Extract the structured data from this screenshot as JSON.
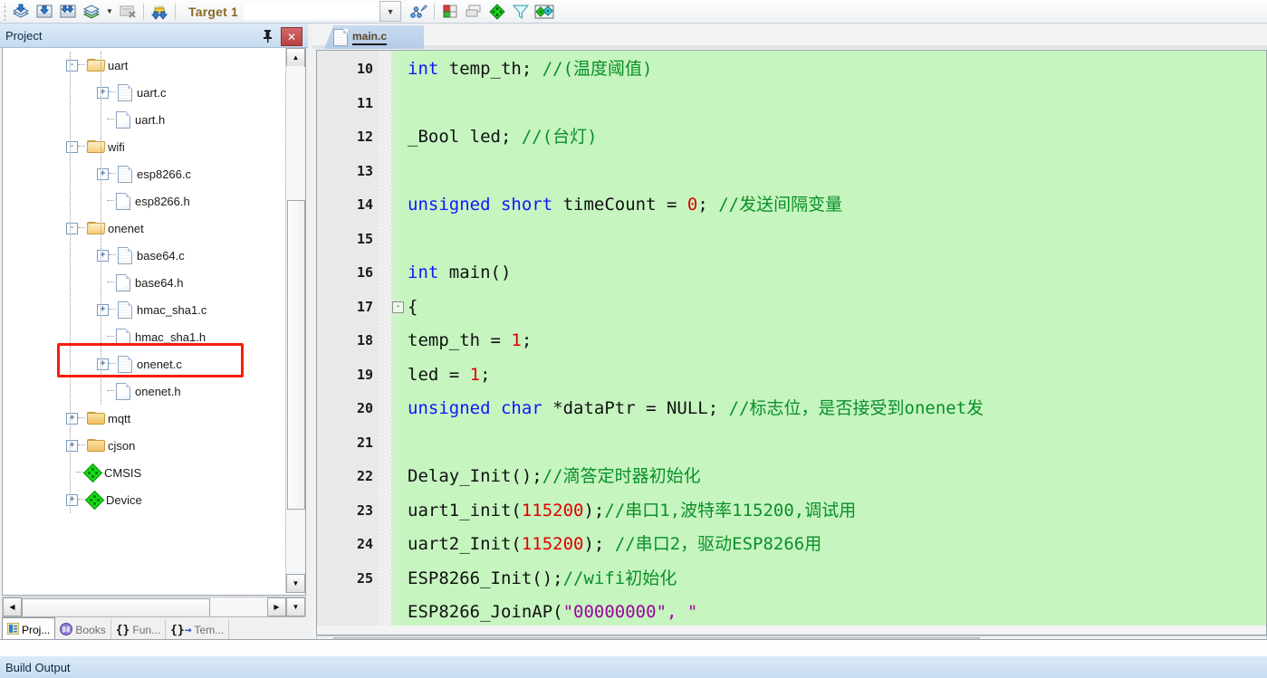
{
  "toolbar": {
    "icons": [
      "build-target-icon",
      "download-to-flash-icon",
      "download-all-icon",
      "batch-build-icon",
      "batch-build-dropdown-icon",
      "translate-file-icon",
      "options-for-target-icon"
    ],
    "target_label": "Target 1",
    "target_dropdown_icon": "chevron-down-icon",
    "right_icons": [
      "manage-runtime-env-icon",
      "new-window-icon",
      "multi-project-icon",
      "diamond-green-icon",
      "filter-icon",
      "pack-installer-icon"
    ]
  },
  "project_panel": {
    "title": "Project",
    "pin_icon": "pin-icon",
    "close_icon": "close-icon",
    "tree": [
      {
        "label": "uart",
        "depth": 1,
        "toggle": "-",
        "icon": "folder-open-icon",
        "row": 0
      },
      {
        "label": "uart.c",
        "depth": 2,
        "toggle": "+",
        "icon": "c-file-icon",
        "row": 1
      },
      {
        "label": "uart.h",
        "depth": 2,
        "toggle": "",
        "icon": "h-file-icon",
        "row": 2
      },
      {
        "label": "wifi",
        "depth": 1,
        "toggle": "-",
        "icon": "folder-open-icon",
        "row": 3
      },
      {
        "label": "esp8266.c",
        "depth": 2,
        "toggle": "+",
        "icon": "c-file-icon",
        "row": 4
      },
      {
        "label": "esp8266.h",
        "depth": 2,
        "toggle": "",
        "icon": "h-file-icon",
        "row": 5
      },
      {
        "label": "onenet",
        "depth": 1,
        "toggle": "-",
        "icon": "folder-open-icon",
        "row": 6
      },
      {
        "label": "base64.c",
        "depth": 2,
        "toggle": "+",
        "icon": "c-file-icon",
        "row": 7
      },
      {
        "label": "base64.h",
        "depth": 2,
        "toggle": "",
        "icon": "h-file-icon",
        "row": 8
      },
      {
        "label": "hmac_sha1.c",
        "depth": 2,
        "toggle": "+",
        "icon": "c-file-icon",
        "row": 9
      },
      {
        "label": "hmac_sha1.h",
        "depth": 2,
        "toggle": "",
        "icon": "h-file-icon",
        "row": 10
      },
      {
        "label": "onenet.c",
        "depth": 2,
        "toggle": "+",
        "icon": "c-file-icon",
        "row": 11,
        "highlighted": true
      },
      {
        "label": "onenet.h",
        "depth": 2,
        "toggle": "",
        "icon": "h-file-icon",
        "row": 12
      },
      {
        "label": "mqtt",
        "depth": 1,
        "toggle": "+",
        "icon": "folder-closed-icon",
        "row": 13
      },
      {
        "label": "cjson",
        "depth": 1,
        "toggle": "+",
        "icon": "folder-closed-icon",
        "row": 14
      },
      {
        "label": "CMSIS",
        "depth": 1,
        "toggle": "",
        "icon": "cmsis-diamond-icon",
        "row": 15
      },
      {
        "label": "Device",
        "depth": 1,
        "toggle": "+",
        "icon": "cmsis-diamond-icon",
        "row": 16
      }
    ],
    "highlight_color": "#f71d0c",
    "scroll": {
      "up_arrow_icon": "scroll-up-icon",
      "down_arrow_icon": "scroll-down-icon",
      "left_arrow_icon": "scroll-left-icon",
      "right_arrow_icon": "scroll-right-icon",
      "dropdown_icon": "scroll-dropdown-icon"
    },
    "tabs": [
      {
        "label": "Proj...",
        "icon": "project-icon",
        "active": true
      },
      {
        "label": "Books",
        "icon": "books-icon",
        "active": false
      },
      {
        "label": "Fun...",
        "icon": "functions-icon",
        "active": false
      },
      {
        "label": "Tem...",
        "icon": "templates-icon",
        "active": false
      }
    ]
  },
  "editor": {
    "tab": {
      "label": "main.c",
      "icon": "c-file-icon"
    },
    "background_color": "#c6f5c0",
    "gutter_color": "#e9e9e9",
    "scroll": {
      "left_arrow_icon": "scroll-left-icon"
    },
    "lines": [
      {
        "num": "10",
        "fold": "",
        "segments": [
          {
            "t": "int",
            "c": "kw"
          },
          {
            "t": " temp_th; ",
            "c": ""
          },
          {
            "t": "//(温度阈值)",
            "c": "cm"
          }
        ]
      },
      {
        "num": "11",
        "fold": "",
        "segments": []
      },
      {
        "num": "12",
        "fold": "",
        "segments": [
          {
            "t": "_Bool led;  ",
            "c": ""
          },
          {
            "t": "//(台灯)",
            "c": "cm"
          }
        ]
      },
      {
        "num": "13",
        "fold": "",
        "segments": []
      },
      {
        "num": "14",
        "fold": "",
        "segments": [
          {
            "t": "unsigned short",
            "c": "kw"
          },
          {
            "t": " timeCount = ",
            "c": ""
          },
          {
            "t": "0",
            "c": "nm"
          },
          {
            "t": ";   ",
            "c": ""
          },
          {
            "t": "//发送间隔变量",
            "c": "cm"
          }
        ]
      },
      {
        "num": "15",
        "fold": "",
        "segments": []
      },
      {
        "num": "16",
        "fold": "",
        "segments": [
          {
            "t": "int",
            "c": "kw"
          },
          {
            "t": " main()",
            "c": ""
          }
        ]
      },
      {
        "num": "17",
        "fold": "-",
        "segments": [
          {
            "t": "{",
            "c": ""
          }
        ]
      },
      {
        "num": "18",
        "fold": "",
        "segments": [
          {
            "t": "    temp_th = ",
            "c": ""
          },
          {
            "t": "1",
            "c": "nm"
          },
          {
            "t": ";",
            "c": ""
          }
        ]
      },
      {
        "num": "19",
        "fold": "",
        "segments": [
          {
            "t": "    led = ",
            "c": ""
          },
          {
            "t": "1",
            "c": "nm"
          },
          {
            "t": ";",
            "c": ""
          }
        ]
      },
      {
        "num": "20",
        "fold": "",
        "segments": [
          {
            "t": "    ",
            "c": ""
          },
          {
            "t": "unsigned char",
            "c": "kw"
          },
          {
            "t": " *dataPtr = NULL;  ",
            "c": ""
          },
          {
            "t": "//标志位，是否接受到onenet发",
            "c": "cm"
          }
        ]
      },
      {
        "num": "21",
        "fold": "",
        "segments": []
      },
      {
        "num": "22",
        "fold": "",
        "segments": [
          {
            "t": "    Delay_Init();",
            "c": ""
          },
          {
            "t": "//滴答定时器初始化",
            "c": "cm"
          }
        ]
      },
      {
        "num": "23",
        "fold": "",
        "segments": [
          {
            "t": "    uart1_init(",
            "c": ""
          },
          {
            "t": "115200",
            "c": "nm"
          },
          {
            "t": ");",
            "c": ""
          },
          {
            "t": "//串口1,波特率115200,调试用",
            "c": "cm"
          }
        ]
      },
      {
        "num": "24",
        "fold": "",
        "segments": [
          {
            "t": "    uart2_Init(",
            "c": ""
          },
          {
            "t": "115200",
            "c": "nm"
          },
          {
            "t": "); ",
            "c": ""
          },
          {
            "t": "//串口2，驱动ESP8266用",
            "c": "cm"
          }
        ]
      },
      {
        "num": "25",
        "fold": "",
        "segments": [
          {
            "t": "    ESP8266_Init();",
            "c": ""
          },
          {
            "t": "//wifi初始化",
            "c": "cm"
          }
        ]
      },
      {
        "num": "",
        "fold": "",
        "segments": [
          {
            "t": "    ESP8266_JoinAP(",
            "c": ""
          },
          {
            "t": "\"",
            "c": "st"
          },
          {
            "t": "00000000",
            "c": "st"
          },
          {
            "t": "\", \"",
            "c": "st"
          }
        ]
      }
    ]
  },
  "build_output": {
    "title": "Build Output"
  }
}
